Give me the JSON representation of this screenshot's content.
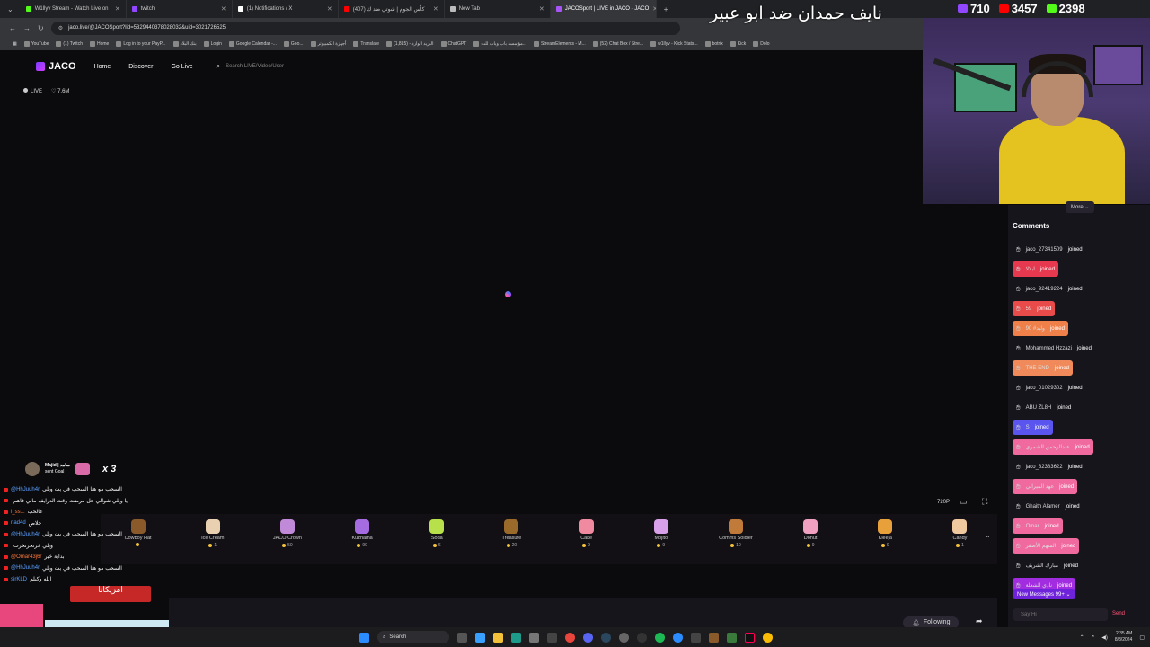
{
  "browser": {
    "tabs": [
      {
        "title": "W1llyv Stream - Watch Live on",
        "color": "#53fc18"
      },
      {
        "title": "twitch",
        "color": "#9146ff"
      },
      {
        "title": "(1) Notifications / X",
        "color": "#ffffff"
      },
      {
        "title": "(407) كأس الجوم | شوتي ضد ك",
        "color": "#ff0000"
      },
      {
        "title": "New Tab",
        "color": "#bbbbbb"
      },
      {
        "title": "JACOSport | LIVE in JACO - JACO",
        "color": "#a855f7",
        "active": true
      }
    ],
    "url": "jaco.live/@JACOSport?lid=5329440378028032&uid=3021726525",
    "bookmarks": [
      "YouTube",
      "(1) Twitch",
      "Home",
      "Log in to your PayP...",
      "بنك البلاد",
      "Login",
      "Google Calendar -...",
      "Goo...",
      "أجهزة الكمبيوتر",
      "Translate",
      "البريد الوارد - (1,815)",
      "ChatGPT",
      "مؤسسة باب وباب للت...",
      "StreamElements - M...",
      "(52) Chat Box / Stre...",
      "w1llyv - Kick Stats...",
      "botrix",
      "Kick",
      "Dolo"
    ]
  },
  "site": {
    "logo": "JACO",
    "nav": [
      "Home",
      "Discover",
      "Go Live"
    ],
    "search_placeholder": "Search LIVE/Video/User",
    "live_label": "LIVE",
    "likes": "7.6M"
  },
  "overlay": {
    "title": "نايف حمدان ضد ابو عبير",
    "stats": [
      {
        "value": "710",
        "color": "#9146ff"
      },
      {
        "value": "3457",
        "color": "#ff0000"
      },
      {
        "value": "2398",
        "color": "#53fc18"
      }
    ]
  },
  "comments": {
    "more_label": "More",
    "title": "Comments",
    "items": [
      {
        "user": "jaco_27341509",
        "label": "joined",
        "bg": ""
      },
      {
        "user": "ابلالا",
        "label": "joined",
        "bg": "#e6394f"
      },
      {
        "user": "jaco_92419224",
        "label": "joined",
        "bg": ""
      },
      {
        "user": "59",
        "label": "joined",
        "bg": "#e94a4a"
      },
      {
        "user": "وليد# 90",
        "label": "joined",
        "bg": "#f0804a"
      },
      {
        "user": "Mohammed Hzzazi",
        "label": "joined",
        "bg": ""
      },
      {
        "user": "THE END",
        "label": "joined",
        "bg": "#f08a5a"
      },
      {
        "user": "jaco_01029302",
        "label": "joined",
        "bg": ""
      },
      {
        "user": "ABU ZL8H",
        "label": "joined",
        "bg": ""
      },
      {
        "user": "S",
        "label": "joined",
        "bg": "#5b55f0"
      },
      {
        "user": "عبدالرحمن الشمري",
        "label": "joined",
        "bg": "#f06aa0"
      },
      {
        "user": "jaco_82383622",
        "label": "joined",
        "bg": ""
      },
      {
        "user": "عهد الميراني",
        "label": "joined",
        "bg": "#f06aa0"
      },
      {
        "user": "Ghaith Alamer",
        "label": "joined",
        "bg": ""
      },
      {
        "user": "Omar",
        "label": "joined",
        "bg": "#f06aa0"
      },
      {
        "user": "السهم الأصفر",
        "label": "joined",
        "bg": "#f06aa0"
      },
      {
        "user": "مبارك الشريف",
        "label": "joined",
        "bg": ""
      },
      {
        "user": "نادي الشعلة",
        "label": "joined",
        "bg": "#a12ce0"
      }
    ],
    "new_messages": "New Messages 99+",
    "say_placeholder": "Say Hi",
    "send_label": "Send"
  },
  "player": {
    "quality": "720P",
    "gifts": [
      {
        "name": "Cowboy Hat",
        "price": "",
        "color": "#8a5a2a"
      },
      {
        "name": "Ice Cream",
        "price": "1",
        "color": "#e8d0b0"
      },
      {
        "name": "JACO Crown",
        "price": "50",
        "color": "#c08ad8"
      },
      {
        "name": "Kuzhama",
        "price": "99",
        "color": "#a56be0"
      },
      {
        "name": "Soda",
        "price": "6",
        "color": "#b8e04a"
      },
      {
        "name": "Treasure",
        "price": "20",
        "color": "#9a6a2a"
      },
      {
        "name": "Cake",
        "price": "9",
        "color": "#f08aa0"
      },
      {
        "name": "Mojito",
        "price": "9",
        "color": "#d8a0e8"
      },
      {
        "name": "Comms Soldier",
        "price": "10",
        "color": "#c07a3a"
      },
      {
        "name": "Donut",
        "price": "9",
        "color": "#f0a0c0"
      },
      {
        "name": "Kleeja",
        "price": "9",
        "color": "#e8a03a"
      },
      {
        "name": "Candy",
        "price": "1",
        "color": "#f0c8a0"
      }
    ],
    "follow_label": "Following"
  },
  "stream_chat": {
    "gift_user": "Majid | سامد",
    "gift_action": "sent Goal",
    "gift_count": "x 3",
    "lines": [
      {
        "name": "@HhJuuh4r",
        "text": "السحب مو هنا السحب في بث ويلي",
        "red": false
      },
      {
        "name": "",
        "text": "يا ويلي شوالي حل مرضت وقت الدرايف ماني فاهم",
        "red": false
      },
      {
        "name": "l_ss...",
        "text": "عالحب",
        "red": true
      },
      {
        "name": "nad4d",
        "text": "خلاص",
        "red": false
      },
      {
        "name": "@HhJuuh4r",
        "text": "السحب مو هنا السحب في بث ويلي",
        "red": false
      },
      {
        "name": "",
        "text": "ويلي خرتخرتخرت",
        "red": false
      },
      {
        "name": "@Omar43j6r",
        "text": "بداية خير",
        "red": true
      },
      {
        "name": "@HhJuuh4r",
        "text": "السحب مو هنا السحب في بث ويلي",
        "red": false
      },
      {
        "name": "sirKLD",
        "text": "الله وكيلم",
        "red": false
      }
    ],
    "promo_sign": "امريكانا"
  },
  "taskbar": {
    "search_label": "Search",
    "time": "2:35 AM",
    "date": "8/8/2024"
  }
}
